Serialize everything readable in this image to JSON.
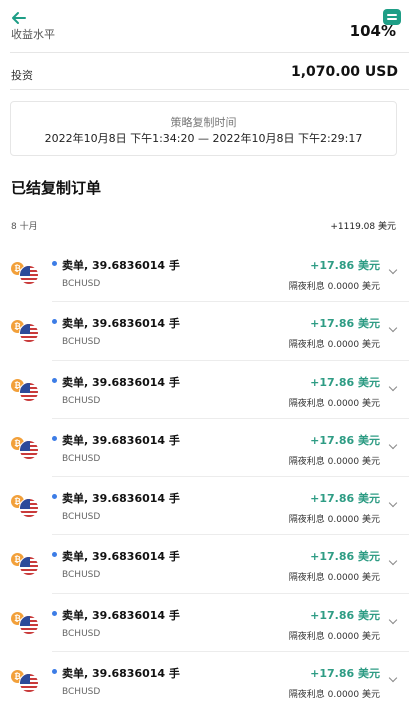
{
  "header": {
    "back_icon": "arrow-left-icon",
    "label": "收益水平",
    "value": "104%",
    "chat_icon": "chat-icon",
    "accent": "#1e9e86"
  },
  "investment": {
    "label": "投资",
    "value": "1,070.00 USD"
  },
  "strategy": {
    "title": "策略复制时间",
    "time_range": "2022年10月8日 下午1:34:20 — 2022年10月8日 下午2:29:17"
  },
  "closed_orders": {
    "title": "已结复制订单",
    "month_label": "8 十月",
    "month_total": "+1119.08 美元",
    "items": [
      {
        "title": "卖单, 39.6836014 手",
        "symbol": "BCHUSD",
        "profit": "+17.86 美元",
        "swap": "隔夜利息 0.0000 美元"
      },
      {
        "title": "卖单, 39.6836014 手",
        "symbol": "BCHUSD",
        "profit": "+17.86 美元",
        "swap": "隔夜利息 0.0000 美元"
      },
      {
        "title": "卖单, 39.6836014 手",
        "symbol": "BCHUSD",
        "profit": "+17.86 美元",
        "swap": "隔夜利息 0.0000 美元"
      },
      {
        "title": "卖单, 39.6836014 手",
        "symbol": "BCHUSD",
        "profit": "+17.86 美元",
        "swap": "隔夜利息 0.0000 美元"
      },
      {
        "title": "卖单, 39.6836014 手",
        "symbol": "BCHUSD",
        "profit": "+17.86 美元",
        "swap": "隔夜利息 0.0000 美元"
      },
      {
        "title": "卖单, 39.6836014 手",
        "symbol": "BCHUSD",
        "profit": "+17.86 美元",
        "swap": "隔夜利息 0.0000 美元"
      },
      {
        "title": "卖单, 39.6836014 手",
        "symbol": "BCHUSD",
        "profit": "+17.86 美元",
        "swap": "隔夜利息 0.0000 美元"
      },
      {
        "title": "卖单, 39.6836014 手",
        "symbol": "BCHUSD",
        "profit": "+17.86 美元",
        "swap": "隔夜利息 0.0000 美元"
      }
    ]
  },
  "colors": {
    "profit": "#2e9c84",
    "order_dot": "#3d7de6",
    "coin": "#f2a03a"
  },
  "icons": {
    "coin": "bitcoin-icon",
    "flag": "us-flag-icon",
    "expand": "chevron-down-icon"
  }
}
